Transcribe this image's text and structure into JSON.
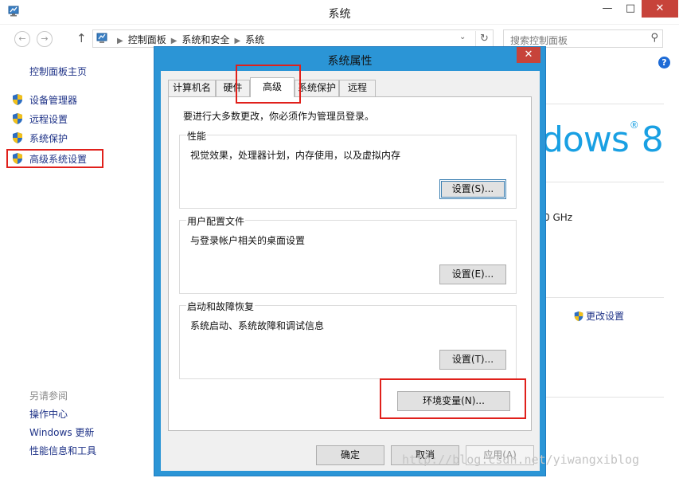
{
  "window": {
    "title": "系统",
    "controls": {
      "minimize": "—",
      "maximize": "□",
      "close": "✕"
    }
  },
  "nav": {
    "back": "←",
    "forward": "→",
    "up": "↑",
    "breadcrumbs": [
      "控制面板",
      "系统和安全",
      "系统"
    ],
    "dropdown": "⌄",
    "refresh": "↻",
    "search_placeholder": "搜索控制面板",
    "search_icon": "⚲"
  },
  "help": "?",
  "sidebar": {
    "home": "控制面板主页",
    "items": [
      {
        "label": "设备管理器",
        "icon": "uac-shield-icon"
      },
      {
        "label": "远程设置",
        "icon": "uac-shield-icon"
      },
      {
        "label": "系统保护",
        "icon": "uac-shield-icon"
      },
      {
        "label": "高级系统设置",
        "icon": "uac-shield-icon",
        "highlighted": true
      }
    ],
    "see_also_title": "另请参阅",
    "see_also": [
      "操作中心",
      "Windows 更新",
      "性能信息和工具"
    ]
  },
  "background": {
    "windows_logo_text": "dows",
    "windows_logo_mark": "®",
    "windows_logo_version": "8",
    "cpu_speed": "0 GHz",
    "change_settings": "更改设置"
  },
  "dialog": {
    "title": "系统属性",
    "close": "✕",
    "tabs": [
      "计算机名",
      "硬件",
      "高级",
      "系统保护",
      "远程"
    ],
    "active_tab": "高级",
    "note": "要进行大多数更改，你必须作为管理员登录。",
    "groups": [
      {
        "title": "性能",
        "desc": "视觉效果，处理器计划，内存使用，以及虚拟内存",
        "button": "设置(S)..."
      },
      {
        "title": "用户配置文件",
        "desc": "与登录帐户相关的桌面设置",
        "button": "设置(E)..."
      },
      {
        "title": "启动和故障恢复",
        "desc": "系统启动、系统故障和调试信息",
        "button": "设置(T)..."
      }
    ],
    "env_button": "环境变量(N)...",
    "ok": "确定",
    "cancel": "取消",
    "apply": "应用(A)"
  },
  "watermark": "http://blog.csdn.net/yiwangxiblog",
  "colors": {
    "dialog_frame": "#2b95d6",
    "close_button": "#c7433a",
    "link": "#1e3287",
    "highlight_box": "#e0201b",
    "win8_logo": "#19a0e3"
  }
}
